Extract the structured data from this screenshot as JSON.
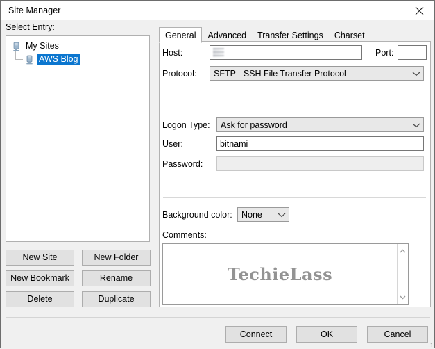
{
  "window": {
    "title": "Site Manager",
    "close_label": "×"
  },
  "left": {
    "select_entry_label": "Select Entry:",
    "tree": [
      {
        "label": "My Sites",
        "icon": "server-icon",
        "selected": false,
        "level": 0
      },
      {
        "label": "AWS Blog",
        "icon": "server-icon",
        "selected": true,
        "level": 1
      }
    ],
    "buttons": [
      {
        "label": "New Site"
      },
      {
        "label": "New Folder"
      },
      {
        "label": "New Bookmark"
      },
      {
        "label": "Rename"
      },
      {
        "label": "Delete"
      },
      {
        "label": "Duplicate"
      }
    ]
  },
  "tabs": [
    {
      "label": "General",
      "active": true
    },
    {
      "label": "Advanced",
      "active": false
    },
    {
      "label": "Transfer Settings",
      "active": false
    },
    {
      "label": "Charset",
      "active": false
    }
  ],
  "general": {
    "host_label": "Host:",
    "host_value": "",
    "port_label": "Port:",
    "port_value": "",
    "protocol_label": "Protocol:",
    "protocol_value": "SFTP - SSH File Transfer Protocol",
    "logon_type_label": "Logon Type:",
    "logon_type_value": "Ask for password",
    "user_label": "User:",
    "user_value": "bitnami",
    "password_label": "Password:",
    "password_value": "",
    "background_color_label": "Background color:",
    "background_color_value": "None",
    "comments_label": "Comments:",
    "comments_value": "",
    "watermark": "TechieLass"
  },
  "footer": {
    "buttons": [
      {
        "label": "Connect"
      },
      {
        "label": "OK"
      },
      {
        "label": "Cancel"
      }
    ]
  },
  "colors": {
    "selection_blue": "#0b76cf",
    "dialog_bg": "#f0f0f0",
    "panel_bg": "#ffffff",
    "button_bg": "#e1e1e1",
    "watermark_gray": "#8a8a8a"
  }
}
